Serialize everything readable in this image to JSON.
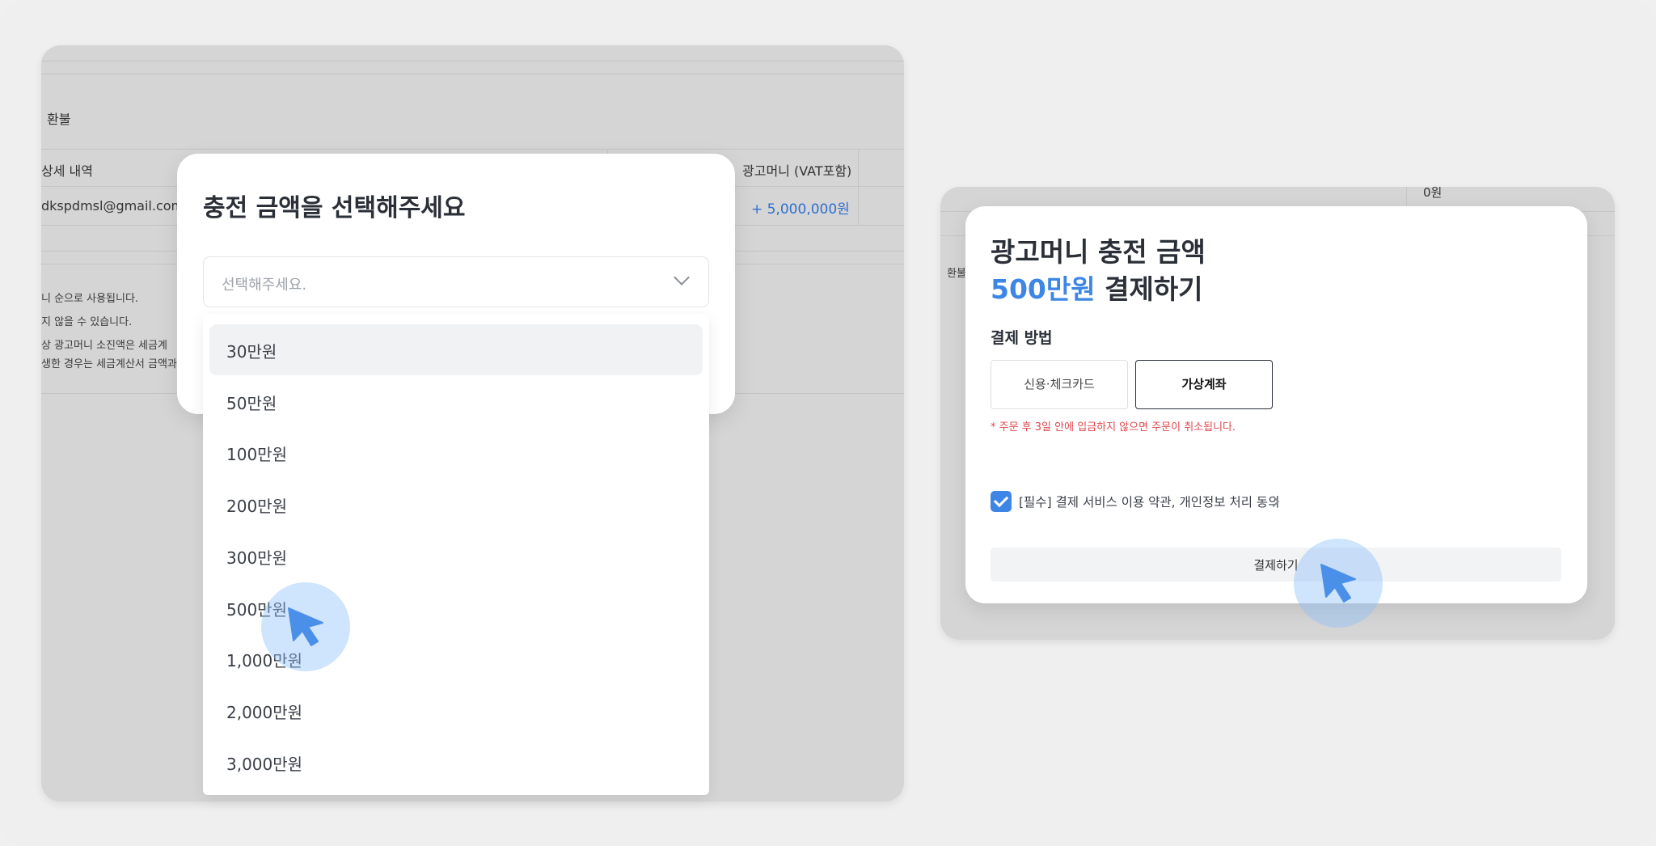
{
  "left_background": {
    "tab_refund": "환불",
    "col_detail": "상세 내역",
    "col_admoney": "광고머니 (VAT포함)",
    "row_email": "dkspdmsl@gmail.com",
    "row_amount": "+ 5,000,000원",
    "notes": [
      "니 순으로 사용됩니다.",
      "지 않을 수 있습니다.",
      "상 광고머니 소진액은 세금계",
      "생한 경우는 세금계산서 금액과"
    ]
  },
  "charge_modal": {
    "title": "충전 금액을 선택해주세요",
    "select_placeholder": "선택해주세요.",
    "options": [
      "30만원",
      "50만원",
      "100만원",
      "200만원",
      "300만원",
      "500만원",
      "1,000만원",
      "2,000만원",
      "3,000만원"
    ],
    "highlighted_option": "30만원"
  },
  "right_background": {
    "tab_refund": "환불",
    "cell_partial": "0원"
  },
  "payment_modal": {
    "title_line1": "광고머니 충전 금액",
    "amount": "500만원",
    "title_line2_suffix": " 결제하기",
    "method_label": "결제 방법",
    "methods": [
      "신용·체크카드",
      "가상계좌"
    ],
    "selected_method": "가상계좌",
    "warning": "* 주문 후 3일 안에 입금하지 않으면 주문이 취소됩니다.",
    "agreement": "[필수] 결제 서비스 이용 약관, 개인정보 처리 동의",
    "agreement_checked": true,
    "submit_label": "결제하기"
  },
  "colors": {
    "accent": "#3d86e6",
    "warning": "#e0464d",
    "overlay": "#d5d5d5",
    "cursor": "#4a90e8"
  },
  "icons": [
    "chevron-down-icon",
    "check-icon",
    "chevron-right-icon",
    "cursor-icon"
  ]
}
